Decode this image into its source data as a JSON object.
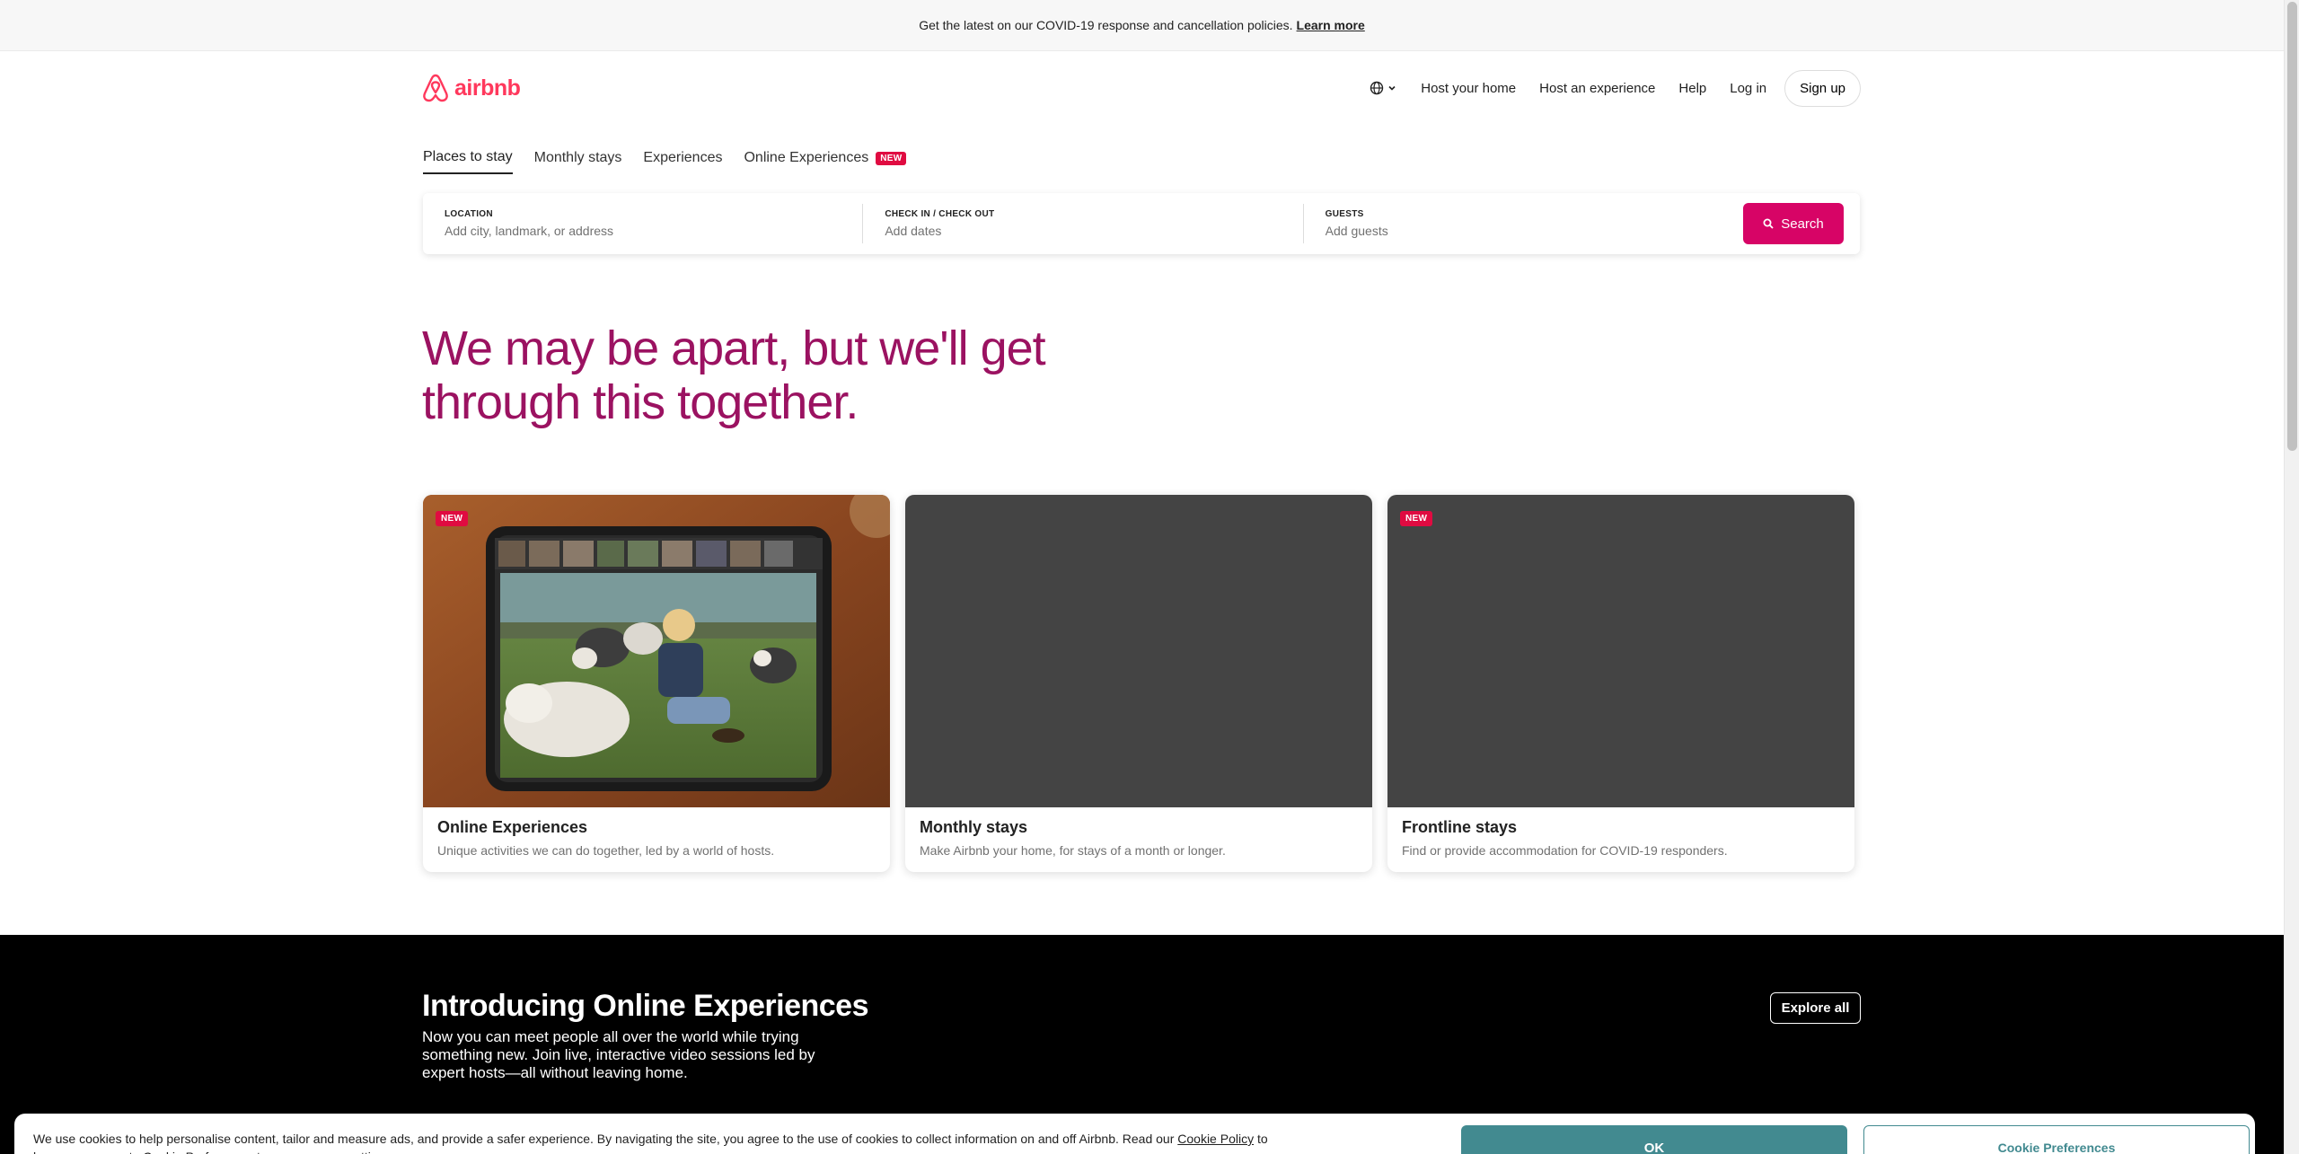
{
  "banner": {
    "text": "Get the latest on our COVID-19 response and cancellation policies.",
    "link": "Learn more"
  },
  "header": {
    "logo_text": "airbnb",
    "nav": [
      "Host your home",
      "Host an experience",
      "Help",
      "Log in"
    ],
    "signup": "Sign up"
  },
  "tabs": [
    {
      "label": "Places to stay",
      "active": true
    },
    {
      "label": "Monthly stays",
      "active": false
    },
    {
      "label": "Experiences",
      "active": false
    },
    {
      "label": "Online Experiences",
      "active": false,
      "badge": "NEW"
    }
  ],
  "search": {
    "location_label": "LOCATION",
    "location_placeholder": "Add city, landmark, or address",
    "dates_label": "CHECK IN / CHECK OUT",
    "dates_placeholder": "Add dates",
    "guests_label": "GUESTS",
    "guests_placeholder": "Add guests",
    "button": "Search"
  },
  "headline": "We may be apart, but we'll get through this together.",
  "cards": [
    {
      "title": "Online Experiences",
      "subtitle": "Unique activities we can do together, led by a world of hosts.",
      "badge": "NEW"
    },
    {
      "title": "Monthly stays",
      "subtitle": "Make Airbnb your home, for stays of a month or longer.",
      "badge": ""
    },
    {
      "title": "Frontline stays",
      "subtitle": "Find or provide accommodation for COVID-19 responders.",
      "badge": "NEW"
    }
  ],
  "intro": {
    "title": "Introducing Online Experiences",
    "text": "Now you can meet people all over the world while trying something new. Join live, interactive video sessions led by expert hosts—all without leaving home.",
    "button": "Explore all"
  },
  "cookie": {
    "text": "We use cookies to help personalise content, tailor and measure ads, and provide a safer experience. By navigating the site, you agree to the use of cookies to collect information on and off Airbnb. Read our",
    "link": "Cookie Policy",
    "text2": "to learn more or go to Cookie Preferences to manage your settings.",
    "ok": "OK",
    "preferences": "Cookie Preferences"
  },
  "colors": {
    "brand": "#ff385c",
    "search_button": "#d70466",
    "headline": "#9b1261",
    "cookie_accent": "#428a90"
  }
}
